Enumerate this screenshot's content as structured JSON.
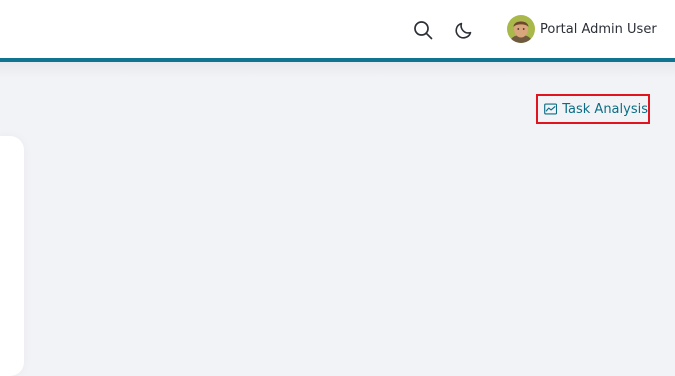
{
  "colors": {
    "accent": "#0e7490",
    "link": "#0b6d85",
    "highlight": "#e0141e"
  },
  "header": {
    "search_icon": "search-icon",
    "theme_icon": "moon-icon",
    "user": {
      "avatar_icon": "user-avatar",
      "name": "Portal Admin User"
    }
  },
  "toolbar": {
    "task_analysis": {
      "icon": "chart-line-icon",
      "label": "Task Analysis"
    }
  }
}
